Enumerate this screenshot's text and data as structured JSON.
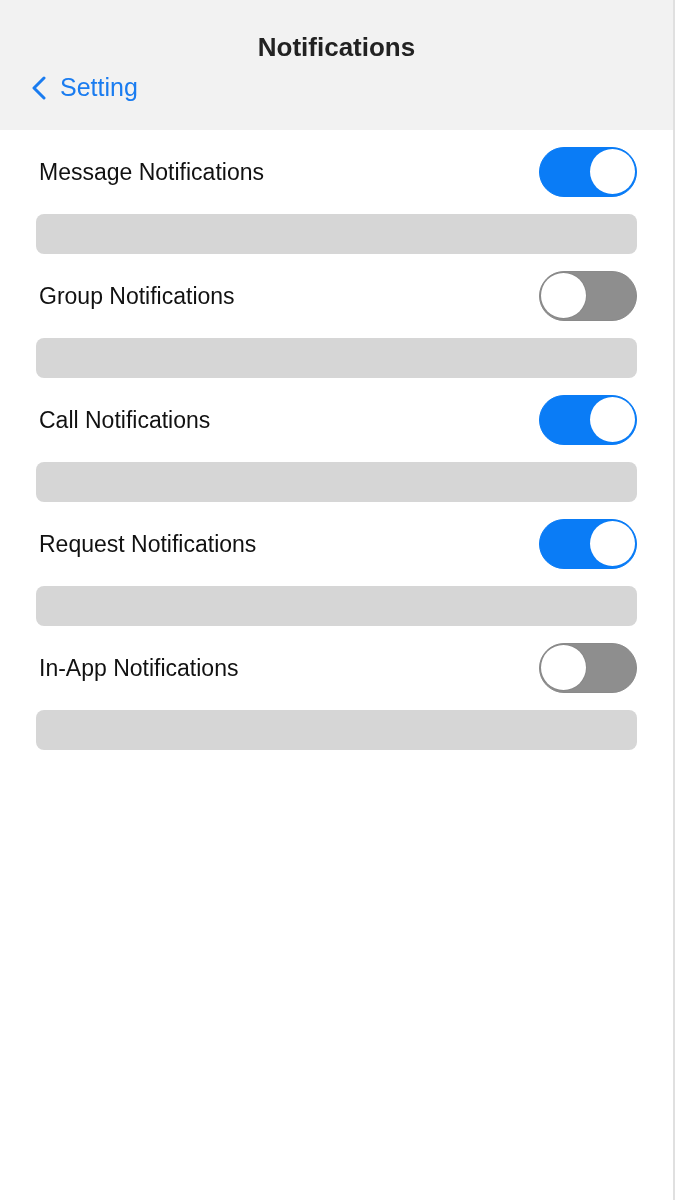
{
  "header": {
    "title": "Notifications",
    "back": "Setting"
  },
  "settings": [
    {
      "label": "Message Notifications",
      "on": true
    },
    {
      "label": "Group Notifications",
      "on": false
    },
    {
      "label": "Call Notifications",
      "on": true
    },
    {
      "label": "Request Notifications",
      "on": true
    },
    {
      "label": "In-App Notifications",
      "on": false
    }
  ]
}
